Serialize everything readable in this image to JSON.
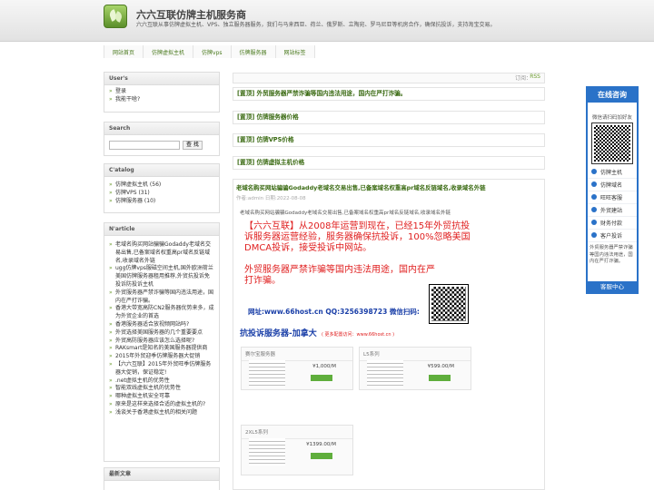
{
  "header": {
    "title": "六六互联仿牌主机服务商",
    "description": "六六互联从事仿牌虚拟主机、VPS、独立服务器服务，我们与马来西亚、荷兰、俄罗斯、立陶宛、罗马尼亚等机房合作，确保抗投诉，支持淘宝交易。"
  },
  "nav": [
    "网站首页",
    "仿牌虚拟主机",
    "仿牌vps",
    "仿牌服务器",
    "网站标签"
  ],
  "sidebar": {
    "users": {
      "title": "User's",
      "items": [
        "登录",
        "我能干啥?"
      ]
    },
    "search": {
      "title": "Search",
      "button": "查 找"
    },
    "catalog": {
      "title": "C'atalog",
      "items": [
        "仿牌虚拟主机 (56)",
        "仿牌VPS (31)",
        "仿牌服务器 (10)"
      ]
    },
    "articles": {
      "title": "N'article",
      "items": [
        "老域名购买网站骗骗Godaddy老域名交易出售,已备案域名权重高pr域名反链域名,收录域名外链",
        "ugg仿牌vps服磁空间主机,国外欧洲荷兰美国仿牌服务器租用推荐,外贸抗投诉免投诉防投诉主机",
        "外贸服务器严禁诈骗等国内违法用途，国内在严打诈骗。",
        "香港大带宽高防CN2服务器优势来多，成为外贸企业的首选",
        "香港服务器适合放视频网站吗?",
        "外贸选择美国服务器的几个重要要点",
        "外贸高防服务器应该怎么选择呢?",
        "RAKsmart是知名的美国服务器提供商",
        "2015年外贸迎季仿牌服务器大促销",
        "【六六互联】2015年外贸旺季仿牌服务器大促销，保证稳定!",
        ".net虚拟主机的优势性",
        "智能双线虚拟主机的优势性",
        "哪种虚拟主机安全可靠",
        "原来是这样来选择合适的虚拟主机的?",
        "浅谈关于香港虚拟主机的相关问题"
      ]
    },
    "recent": {
      "title": "最新文章"
    }
  },
  "subscribe": {
    "label": "订阅：",
    "rss": "RSS"
  },
  "posts": [
    "[置顶] 外贸服务器严禁诈骗等国内违法用途，国内在严打诈骗。",
    "[置顶] 仿牌服务器价格",
    "[置顶] 仿牌VPS价格",
    "[置顶] 仿牌虚拟主机价格"
  ],
  "article": {
    "title": "老域名购买网站骗骗Godaddy老域名交易出售,已备案域名权重高pr域名反链域名,收录域名外链",
    "meta": "作者:admin 日期:2022-08-08",
    "summary": "老域名购买网站骗骗Godaddy老域名交易出售,已备案域名权重高pr域名反链域名,收录域名外链",
    "banner_line1": "【六六互联】从2008年运营到现在，已经15年外贸抗投诉服务器运营经验，服务器确保抗投诉，100%忽略美国DMCA投诉，接受投诉中网站。",
    "banner_line2": "外贸服务器严禁诈骗等国内违法用途，国内在严打诈骗。",
    "banner_website": "网址:www.66host.cn QQ:3256398723 微信扫码:",
    "banner2_title": "抗投诉服务器-加拿大",
    "banner2_note": "( 更多配置访问：www.66host.cn )",
    "products": [
      {
        "name": "赛尔宝服务器",
        "price": "¥1,000/M"
      },
      {
        "name": "L5系列",
        "price": "¥599.00/M"
      },
      {
        "name": "2XL5系列",
        "price": "¥1399.00/M"
      }
    ]
  },
  "float_panel": {
    "header": "在线咨询",
    "wechat_label": "微信请扫码加好友",
    "items": [
      "仿牌主机",
      "仿牌域名",
      "旺旺客服",
      "外贸建站",
      "财务付款",
      "客户投诉"
    ],
    "note": "外贸服务器严禁诈骗等国内违法用途，国内在严打诈骗。",
    "footer": "客服中心"
  }
}
